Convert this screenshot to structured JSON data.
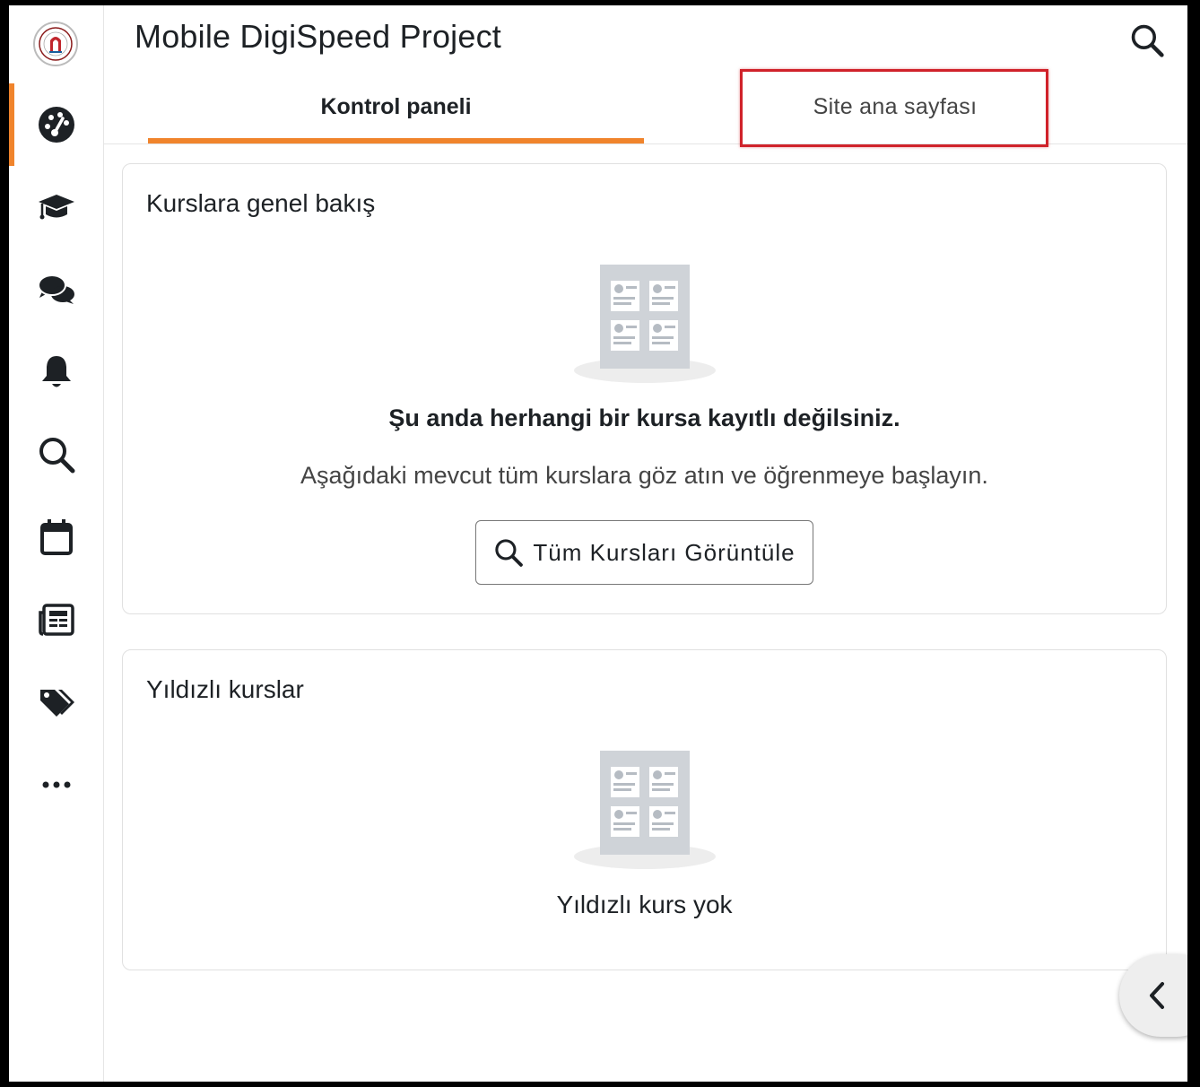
{
  "app": {
    "title": "Mobile DigiSpeed Project"
  },
  "header": {
    "search_icon": "search-icon"
  },
  "tabs": [
    {
      "label": "Kontrol paneli",
      "active": true
    },
    {
      "label": "Site ana sayfası",
      "active": false
    }
  ],
  "sidebar": {
    "items": [
      {
        "icon": "dashboard-icon",
        "active": true
      },
      {
        "icon": "courses-icon"
      },
      {
        "icon": "messages-icon"
      },
      {
        "icon": "notifications-icon"
      },
      {
        "icon": "search-icon"
      },
      {
        "icon": "calendar-icon"
      },
      {
        "icon": "news-icon"
      },
      {
        "icon": "tags-icon"
      },
      {
        "icon": "more-icon"
      }
    ]
  },
  "course_overview": {
    "title": "Kurslara genel bakış",
    "empty_title": "Şu anda herhangi bir kursa kayıtlı değilsiniz.",
    "empty_desc": "Aşağıdaki mevcut tüm kurslara göz atın ve öğrenmeye başlayın.",
    "button_label": "Tüm Kursları Görüntüle"
  },
  "starred": {
    "title": "Yıldızlı kurslar",
    "empty_text": "Yıldızlı kurs yok"
  },
  "colors": {
    "accent": "#f0842c",
    "highlight": "#d0222a"
  }
}
